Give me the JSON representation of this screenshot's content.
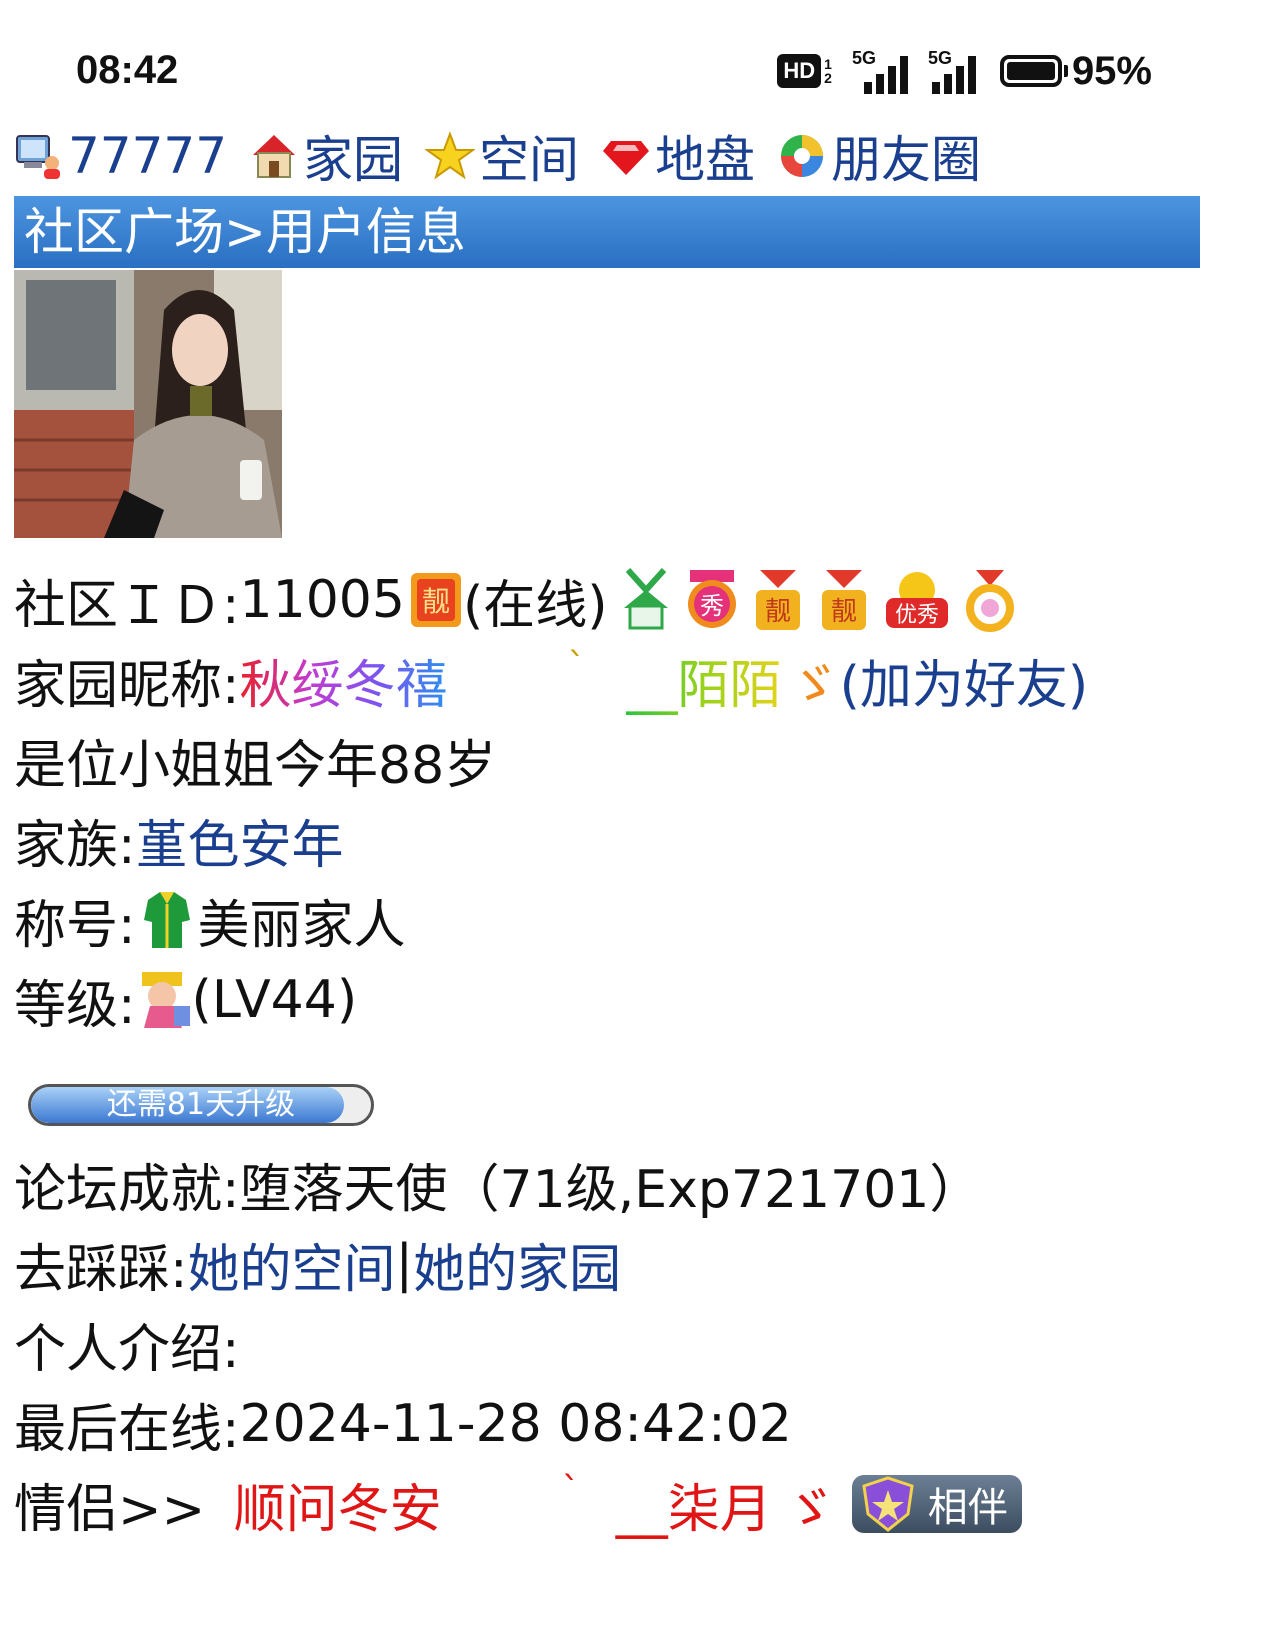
{
  "status_bar": {
    "time": "08:42",
    "hd_label": "HD",
    "hd_sub_top": "1",
    "hd_sub_bottom": "2",
    "signal1_label": "5G",
    "signal2_label": "5G",
    "battery_percent": "95%"
  },
  "nav": {
    "items": [
      {
        "label": "77777",
        "icon": "computer-user-icon"
      },
      {
        "label": "家园",
        "icon": "home-icon"
      },
      {
        "label": "空间",
        "icon": "star-icon"
      },
      {
        "label": "地盘",
        "icon": "diamond-icon"
      },
      {
        "label": "朋友圈",
        "icon": "camera-aperture-icon"
      }
    ]
  },
  "page": {
    "breadcrumb": "社区广场>用户信息"
  },
  "profile": {
    "id_label": "社区ＩＤ:",
    "id_value": "11005",
    "online_status": "(在线)",
    "nickname_label": "家园昵称:",
    "nickname_part1": "秋绥冬禧",
    "nickname_mark": "ˋ",
    "nickname_part2": "__陌陌",
    "nickname_part3": "ゞ",
    "add_friend": "(加为好友)",
    "age_line": "是位小姐姐今年88岁",
    "clan_label": "家族:",
    "clan_value": "堇色安年",
    "title_label": "称号:",
    "title_value": "美丽家人",
    "level_label": "等级:",
    "level_value": "(LV44)",
    "upgrade_text": "还需81天升级",
    "upgrade_progress": 0.92,
    "forum_label": "论坛成就:",
    "forum_value": "堕落天使（71级,Exp721701）",
    "visit_label": "去踩踩:",
    "visit_space": "她的空间",
    "visit_sep": "|",
    "visit_home": "她的家园",
    "intro_label": "个人介绍:",
    "last_online_label": "最后在线:",
    "last_online_value": "2024-11-28 08:42:02",
    "couple_label": "情侣>> ",
    "couple_part1": "顺问冬安",
    "couple_mark": "ˋ",
    "couple_part2": "__柒月",
    "couple_part3": "ゞ",
    "couple_badge": "相伴"
  },
  "colors": {
    "link": "#1b3f8f",
    "titlebar": "#2a6fc2",
    "couple_red": "#e01515"
  }
}
